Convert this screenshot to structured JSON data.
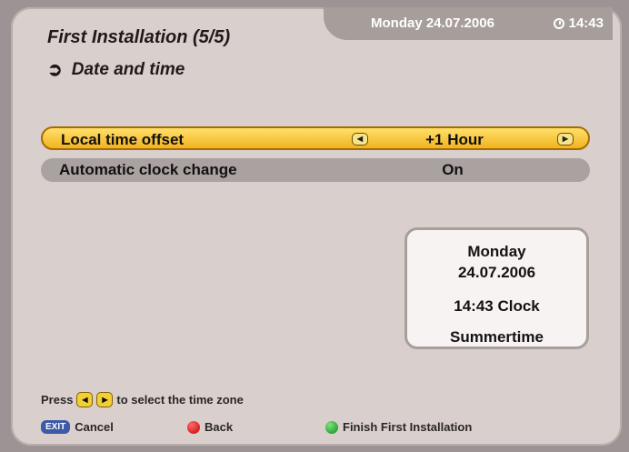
{
  "header": {
    "date": "Monday 24.07.2006",
    "time": "14:43",
    "title": "First Installation (5/5)",
    "subtitle": "Date and time"
  },
  "settings": [
    {
      "label": "Local time offset",
      "value": "+1 Hour",
      "selected": true
    },
    {
      "label": "Automatic clock change",
      "value": "On",
      "selected": false
    }
  ],
  "info_box": {
    "day": "Monday",
    "date": "24.07.2006",
    "clock": "14:43 Clock",
    "mode": "Summertime"
  },
  "hint": {
    "prefix": "Press",
    "suffix": "to select the time zone"
  },
  "footer": {
    "exit_key": "EXIT",
    "cancel": "Cancel",
    "back": "Back",
    "finish": "Finish First Installation"
  },
  "colors": {
    "selection": "#f2b320",
    "background": "#d9cfcc",
    "accent_tab": "#a79e9b"
  }
}
